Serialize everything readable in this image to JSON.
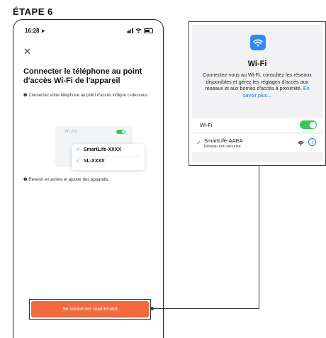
{
  "step_title": "ÉTAPE 6",
  "phone": {
    "status_time": "16:28",
    "title": "Connecter le téléphone au point d'accès Wi-Fi de l'appareil",
    "bullet": "❶",
    "instruction1": "Connectez votre téléphone au point d'accès indiqué ci-dessous :",
    "bullet2": "❷",
    "instruction2": "Revenir en arrière et ajouter des appareils.",
    "mini_list": {
      "wlan_label": "WLAN",
      "items": [
        "SmartLife-XXXX",
        "SL-XXXX"
      ]
    },
    "connect_button": "Se connecter maintenant"
  },
  "wifi_panel": {
    "title": "Wi-Fi",
    "description": "Connectez-vous au Wi-Fi, consultez les réseaux disponibles et gérez les réglages d'accès aux réseaux et aux bornes d'accès à proximité.",
    "learn_more": "En savoir plus...",
    "wifi_label": "Wi-Fi",
    "network_name": "SmartLife-AAEA",
    "network_sub": "Réseau non sécurisé"
  },
  "colors": {
    "accent_orange": "#f26a3d",
    "ios_green": "#34c759",
    "ios_blue": "#2f8af5",
    "link_blue": "#1a73e8"
  }
}
